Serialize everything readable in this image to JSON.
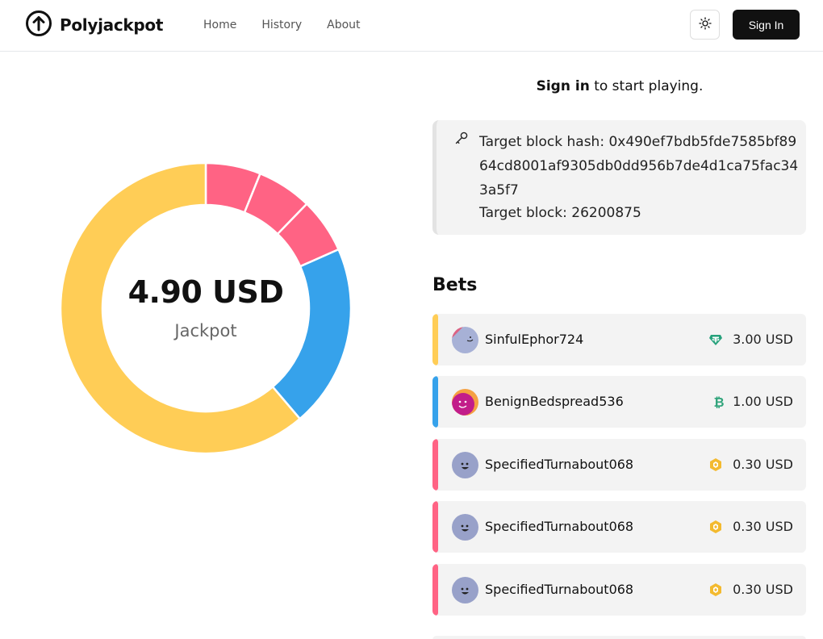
{
  "header": {
    "logo_text": "Polyjackpot",
    "logo_icon": "arrow-up-circle-icon",
    "nav": [
      {
        "label": "Home"
      },
      {
        "label": "History"
      },
      {
        "label": "About"
      }
    ],
    "theme_icon": "sun-icon",
    "sign_in_label": "Sign In"
  },
  "jackpot": {
    "amount": "4.90 USD",
    "label": "Jackpot"
  },
  "donut_chart": {
    "segments": [
      {
        "value": 0.3,
        "color": "#ff6384"
      },
      {
        "value": 0.3,
        "color": "#ff6384"
      },
      {
        "value": 0.3,
        "color": "#ff6384"
      },
      {
        "value": 1.0,
        "color": "#36a2eb"
      },
      {
        "value": 3.0,
        "color": "#ffcd56"
      }
    ]
  },
  "prompt": {
    "strong": "Sign in",
    "rest": " to start playing."
  },
  "target": {
    "key_icon": "key-icon",
    "hash_label": "Target block hash: ",
    "hash_value": "0x490ef7bdb5fde7585bf8964cd8001af9305db0dd956b7de4d1ca75fac343a5f7",
    "block_label": "Target block: ",
    "block_value": "26200875"
  },
  "bets": {
    "title": "Bets",
    "items": [
      {
        "user": "SinfulEphor724",
        "amount": "3.00 USD",
        "coin_icon": "tether-icon",
        "bar_color": "#ffcd56"
      },
      {
        "user": "BenignBedspread536",
        "amount": "1.00 USD",
        "coin_icon": "bitcoin-icon",
        "bar_color": "#36a2eb"
      },
      {
        "user": "SpecifiedTurnabout068",
        "amount": "0.30 USD",
        "coin_icon": "bnb-icon",
        "bar_color": "#ff6384"
      },
      {
        "user": "SpecifiedTurnabout068",
        "amount": "0.30 USD",
        "coin_icon": "bnb-icon",
        "bar_color": "#ff6384"
      },
      {
        "user": "SpecifiedTurnabout068",
        "amount": "0.30 USD",
        "coin_icon": "bnb-icon",
        "bar_color": "#ff6384"
      }
    ]
  }
}
